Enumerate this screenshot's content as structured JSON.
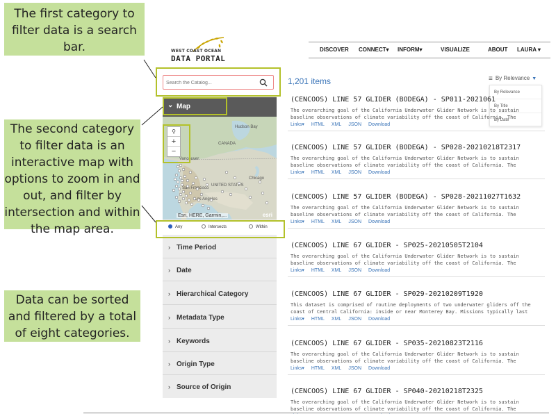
{
  "callouts": {
    "search": "The first category to filter data is a search bar.",
    "map": "The second category to filter data is an interactive map with options to zoom in and out, and filter by intersection and within the map area.",
    "categories": "Data can be sorted and filtered by a total of eight categories."
  },
  "logo": {
    "line1": "WEST COAST OCEAN",
    "line2": "DATA PORTAL"
  },
  "nav": {
    "discover": "DISCOVER",
    "connect": "CONNECT▾",
    "inform": "INFORM▾",
    "visualize": "VISUALIZE",
    "about": "ABOUT",
    "user": "LAURA ▾"
  },
  "search": {
    "placeholder": "Search the Catalog..."
  },
  "map_panel": {
    "label": "Map",
    "zoom_in": "+",
    "zoom_out": "−",
    "attribution": "Esri, HERE, Garmin,...",
    "esri": "esri",
    "places": {
      "hudson": "Hudson Bay",
      "canada": "CANADA",
      "vancouver": "Vancouver",
      "chicago": "Chicago",
      "us": "UNITED STATES",
      "sf": "San Francisco",
      "la": "Los Angeles"
    }
  },
  "spatial_filter": {
    "any": "Any",
    "intersects": "Intersects",
    "within": "Within",
    "selected": "Any"
  },
  "categories": [
    "Time Period",
    "Date",
    "Hierarchical Category",
    "Metadata Type",
    "Keywords",
    "Origin Type",
    "Source of Origin"
  ],
  "results_header": {
    "count": "1,201 items",
    "sort_label": "By Relevance"
  },
  "sort_options": [
    "By Relevance",
    "By Title",
    "By Date"
  ],
  "result_links": [
    "Links▾",
    "HTML",
    "XML",
    "JSON",
    "Download"
  ],
  "results": [
    {
      "title": "(CENCOOS) LINE 57 GLIDER (BODEGA) - SP011-2021061",
      "desc": "The overarching goal of the California Underwater Glider Network is to sustain baseline observations of climate variability off the coast of California. The technical approach is to"
    },
    {
      "title": "(CENCOOS) LINE 57 GLIDER (BODEGA) - SP028-20210218T2317",
      "desc": "The overarching goal of the California Underwater Glider Network is to sustain baseline observations of climate variability off the coast of California. The technical approach is to"
    },
    {
      "title": "(CENCOOS) LINE 57 GLIDER (BODEGA) - SP028-20211027T1632",
      "desc": "The overarching goal of the California Underwater Glider Network is to sustain baseline observations of climate variability off the coast of California. The technical approach is to"
    },
    {
      "title": "(CENCOOS) LINE 67 GLIDER - SP025-20210505T2104",
      "desc": "The overarching goal of the California Underwater Glider Network is to sustain baseline observations of climate variability off the coast of California. The technical approach is to"
    },
    {
      "title": "(CENCOOS) LINE 67 GLIDER - SP029-20210209T1920",
      "desc": "This dataset is comprised of routine deployments of two underwater gliders off the coast of Central California: inside or near Monterey Bay. Missions typically last several weeks, and"
    },
    {
      "title": "(CENCOOS) LINE 67 GLIDER - SP035-20210823T2116",
      "desc": "The overarching goal of the California Underwater Glider Network is to sustain baseline observations of climate variability off the coast of California. The technical approach is to"
    },
    {
      "title": "(CENCOOS) LINE 67 GLIDER - SP040-20210218T2325",
      "desc": "The overarching goal of the California Underwater Glider Network is to sustain baseline observations of climate variability off the coast of California. The technical approach is to"
    }
  ],
  "colors": {
    "callout": "#c5e09b",
    "highlight": "#b3c12a",
    "link": "#3a74b8",
    "header": "#5a5a5a"
  }
}
